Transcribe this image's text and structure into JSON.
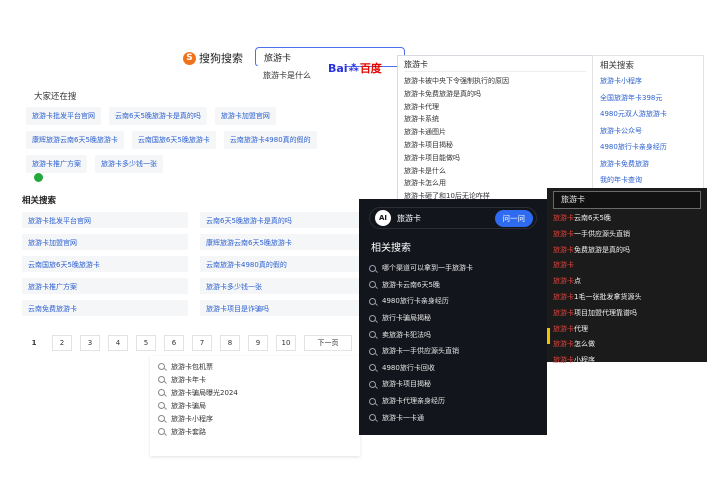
{
  "sogou": {
    "logo_text": "搜狗搜索",
    "logo_mark": "S",
    "query": "旅游卡",
    "suggest": "旅游卡是什么"
  },
  "baidu": {
    "logo_bai": "Bai",
    "logo_paw": "⁂",
    "logo_du": "百度",
    "query": "旅游卡",
    "suggestions": [
      "旅游卡被中央下令强制执行的原因",
      "旅游卡免费旅游是真的吗",
      "旅游卡代理",
      "旅游卡系统",
      "旅游卡通图片",
      "旅游卡项目揭秘",
      "旅游卡项目能做吗",
      "旅游卡是什么",
      "旅游卡怎么用",
      "旅游卡砸了和10后无论咋样"
    ]
  },
  "dajia": {
    "title": "大家还在搜",
    "chips": [
      "旅游卡批发平台官网",
      "云南6天5晚旅游卡是真的吗",
      "旅游卡加盟官网",
      "康辉旅游云南6天5晚旅游卡",
      "云南国旅6天5晚旅游卡",
      "云南旅游卡4980真的假的",
      "旅游卡推广方案",
      "旅游卡多少钱一张"
    ]
  },
  "related_left": {
    "title": "相关搜索",
    "items": [
      "旅游卡批发平台官网",
      "云南6天5晚旅游卡是真的吗",
      "旅游卡加盟官网",
      "康辉旅游云南6天5晚旅游卡",
      "云南国旅6天5晚旅游卡",
      "云南旅游卡4980真的假的",
      "旅游卡推广方案",
      "旅游卡多少钱一张",
      "云南免费旅游卡",
      "旅游卡项目是诈骗吗"
    ]
  },
  "pager": {
    "pages": [
      "1",
      "2",
      "3",
      "4",
      "5",
      "6",
      "7",
      "8",
      "9",
      "10"
    ],
    "next": "下一页"
  },
  "bottom_suggest": [
    "旅游卡包机票",
    "旅游卡年卡",
    "旅游卡骗局曝光2024",
    "旅游卡骗局",
    "旅游卡小程序",
    "旅游卡套路"
  ],
  "related_right": {
    "title": "相关搜索",
    "items": [
      "旅游卡小程序",
      "全国旅游年卡398元",
      "4980元双人游旅游卡",
      "旅游卡公众号",
      "4980旅行卡亲身经历",
      "旅游卡免费旅游",
      "我的年卡查询"
    ]
  },
  "dark_panel": {
    "ai_label": "AI",
    "query": "旅游卡",
    "button": "问一问",
    "title": "相关搜索",
    "items": [
      "哪个渠道可以拿到一手旅游卡",
      "旅游卡云南6天5晚",
      "4980旅行卡亲身经历",
      "旅行卡骗局揭秘",
      "卖旅游卡犯法吗",
      "旅游卡一手供应源头直销",
      "4980旅行卡回收",
      "旅游卡项目揭秘",
      "旅游卡代理亲身经历",
      "旅游卡一卡通"
    ]
  },
  "red_panel": {
    "query": "旅游卡",
    "items": [
      {
        "hl": "旅游卡",
        "rest": "云南6天5晚"
      },
      {
        "hl": "旅游卡",
        "rest": "一手供应源头直销"
      },
      {
        "hl": "旅游卡",
        "rest": "免费旅游是真的吗"
      },
      {
        "hl": "旅游卡",
        "rest": ""
      },
      {
        "hl": "旅游卡",
        "rest": "点"
      },
      {
        "hl": "旅游卡",
        "rest": "1毛一张批发拿货源头"
      },
      {
        "hl": "旅游卡",
        "rest": "项目加盟代理靠谱吗"
      },
      {
        "hl": "旅游卡",
        "rest": "代理"
      },
      {
        "hl": "旅游卡",
        "rest": "怎么做"
      },
      {
        "hl": "旅游卡",
        "rest": "小程序"
      }
    ]
  },
  "colors": {
    "link_blue": "#2b5fcf",
    "baidu_blue": "#2932e1",
    "baidu_red": "#e10602",
    "sogou_orange": "#f2721c",
    "dark_bg": "#13151c",
    "ai_button": "#2e6bf0",
    "red_text": "#e0403a"
  }
}
